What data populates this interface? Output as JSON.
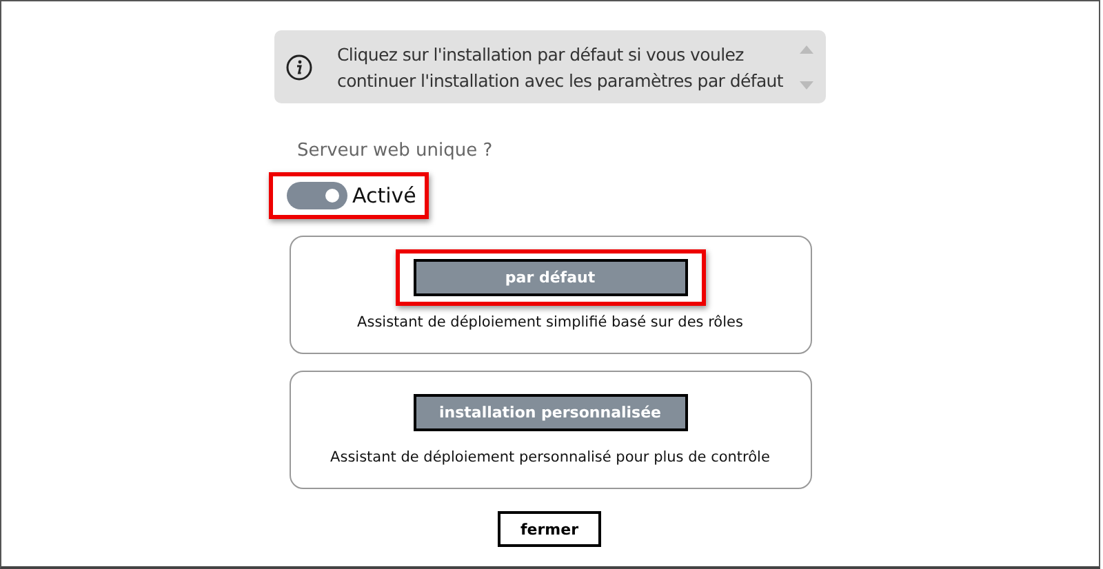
{
  "info": {
    "text": "Cliquez sur l'installation par défaut si vous voulez continuer l'installation avec les paramètres par défaut"
  },
  "toggle": {
    "label": "Serveur web unique ?",
    "on": true,
    "state_text": "Activé",
    "highlighted": true
  },
  "options": [
    {
      "button": "par défaut",
      "description": "Assistant de déploiement simplifié basé sur des rôles",
      "highlighted": true
    },
    {
      "button": "installation personnalisée",
      "description": "Assistant de déploiement personnalisé pour plus de contrôle",
      "highlighted": false
    }
  ],
  "close_button": "fermer"
}
